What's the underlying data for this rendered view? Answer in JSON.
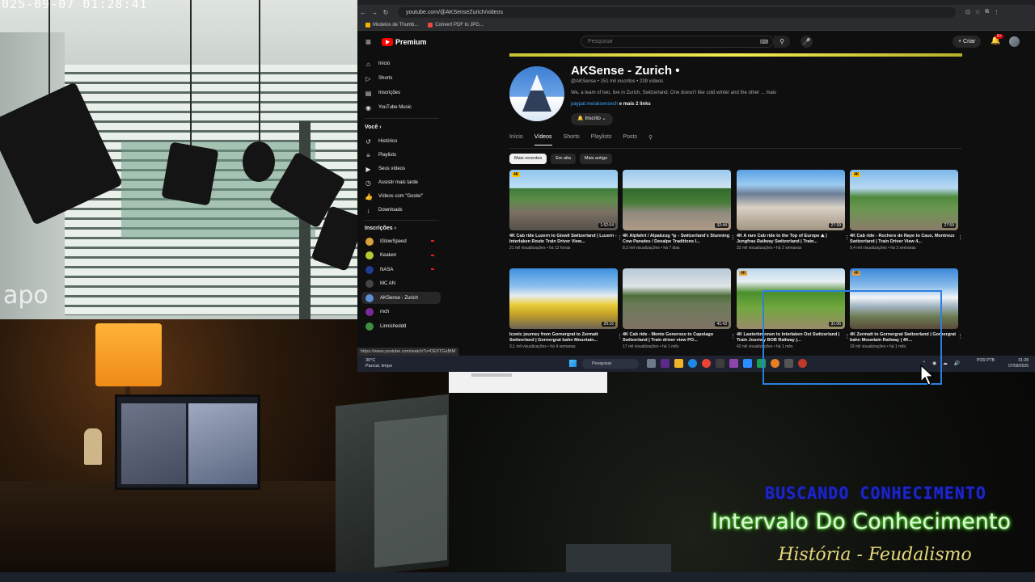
{
  "overlay": {
    "timestamp": "025-09-07 01:28:41",
    "camera_watermark": "apo",
    "banner_line1": "BUSCANDO CONHECIMENTO",
    "banner_line2": "Intervalo Do Conhecimento",
    "banner_line3": "História - Feudalismo"
  },
  "browser": {
    "url": "youtube.com/@AKSenseZurich/videos",
    "bookmarks": [
      "Modelos de Thumb...",
      "Convert PDF to JPG..."
    ],
    "status_url": "https://www.youtube.com/watch?v=DE5TGaBtM"
  },
  "youtube": {
    "logo_text": "Premium",
    "search_placeholder": "Pesquisar",
    "create_label": "+ Criar",
    "notification_count": "9+",
    "sidebar": {
      "main": [
        {
          "label": "Início",
          "icon": "home-icon",
          "glyph": "⌂"
        },
        {
          "label": "Shorts",
          "icon": "shorts-icon",
          "glyph": "▷"
        },
        {
          "label": "Inscrições",
          "icon": "subscriptions-icon",
          "glyph": "▤"
        },
        {
          "label": "YouTube Music",
          "icon": "music-icon",
          "glyph": "◉"
        }
      ],
      "you_header": "Você ›",
      "you": [
        {
          "label": "Histórico",
          "icon": "history-icon",
          "glyph": "↺"
        },
        {
          "label": "Playlists",
          "icon": "playlists-icon",
          "glyph": "≡"
        },
        {
          "label": "Seus vídeos",
          "icon": "your-videos-icon",
          "glyph": "▶"
        },
        {
          "label": "Assistir mais tarde",
          "icon": "watch-later-icon",
          "glyph": "◷"
        },
        {
          "label": "Vídeos com \"Gostei\"",
          "icon": "like-icon",
          "glyph": "👍"
        },
        {
          "label": "Downloads",
          "icon": "download-icon",
          "glyph": "↓"
        }
      ],
      "subs_header": "Inscrições ›",
      "subs": [
        {
          "label": "IGlowSpeed",
          "color": "#d9a33b",
          "live": true
        },
        {
          "label": "Keaken",
          "color": "#b7c934",
          "live": true
        },
        {
          "label": "NASA",
          "color": "#1f3b93",
          "live": true
        },
        {
          "label": "MC AN",
          "color": "#444444",
          "live": false
        },
        {
          "label": "AKSense - Zurich",
          "color": "#5c8fd6",
          "live": false
        },
        {
          "label": "mch",
          "color": "#7b2b9a",
          "live": false
        },
        {
          "label": "Linnisheddd",
          "color": "#3e8f43",
          "live": false
        }
      ]
    },
    "channel": {
      "name": "AKSense - Zurich •",
      "meta": "@AKSense • 151 mil inscritos • 239 vídeos",
      "description": "We, a team of two, live in Zurich, Switzerland. One doesn't like cold winter and the other ... mais",
      "link": "paypal.me/aksensech",
      "link_more": "e mais 2 links",
      "subscribe_label": "🔔 Inscrito ⌄"
    },
    "tabs": [
      "Início",
      "Vídeos",
      "Shorts",
      "Playlists",
      "Posts"
    ],
    "active_tab": 1,
    "chips": [
      "Mais recentes",
      "Em alta",
      "Mais antigo"
    ],
    "active_chip": 0,
    "videos": [
      {
        "title": "4K Cab ride Luzern to Giswil Switzerland | Luzern - Interlaken Route Train Driver View...",
        "meta": "21 mil visualizações • há 12 horas",
        "duration": "1:52:04",
        "tag": "4K",
        "thumb": "cab-lake"
      },
      {
        "title": "4K Alpfahrt / Alpabzug 🐄 - Switzerland's Stunning Cow Parades / Desalpe Traditions I...",
        "meta": "8,3 mil visualizações • há 7 dias",
        "duration": "32:44",
        "tag": "",
        "thumb": "parade"
      },
      {
        "title": "4K A rare Cab ride to the Top of Europe ⛰ | Jungfrau Railway Switzerland | Train...",
        "meta": "32 mil visualizações • há 2 semanas",
        "duration": "27:39",
        "tag": "",
        "thumb": "station"
      },
      {
        "title": "4K Cab ride - Rochers de Naye to Caux, Montreux Switzerland | Train Driver View 4...",
        "meta": "9,4 mil visualizações • há 3 semanas",
        "duration": "27:59",
        "tag": "4K",
        "thumb": "mountain-station"
      },
      {
        "title": "Iconic journey from Gornergrat to Zermatt Switzerland | Gornergrat bahn Mountain...",
        "meta": "3,1 mil visualizações • há 4 semanas",
        "duration": "29:16",
        "tag": "",
        "thumb": "yellow-train"
      },
      {
        "title": "4K Cab ride - Monte Generoso to Capolago Switzerland | Train driver view PO...",
        "meta": "17 mil visualizações • há 1 mês",
        "duration": "41:43",
        "tag": "",
        "thumb": "village-track"
      },
      {
        "title": "4K Lauterbrunnen to Interlaken Ost Switzerland | Train Journey BOB Railway |...",
        "meta": "42 mil visualizações • há 1 mês",
        "duration": "31:06",
        "tag": "4K",
        "thumb": "green-valley"
      },
      {
        "title": "4K Zermatt to Gornergrat Switzerland | Gornergrat bahn Mountain Railway | 4K...",
        "meta": "19 mil visualizações • há 1 mês",
        "duration": "",
        "tag": "4K",
        "thumb": "glacier"
      }
    ]
  },
  "taskbar": {
    "weather_temp": "30°C",
    "weather_desc": "Parcial. limpo",
    "search_label": "Pesquisar",
    "lang": "POR PTB",
    "time": "01:28",
    "date": "07/09/2025"
  },
  "colors": {
    "highlight_border": "#2b7fe0",
    "yt_red": "#ff0000",
    "banner_blue": "#1d25c9",
    "banner_green_glow": "#6fff46",
    "banner_gold": "#e5d77b"
  }
}
